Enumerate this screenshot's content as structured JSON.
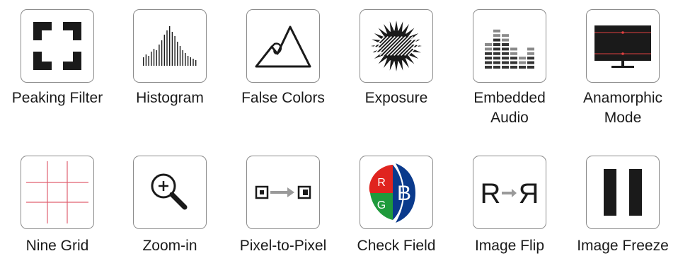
{
  "features": [
    {
      "label": "Peaking Filter",
      "icon": "peaking-filter-icon"
    },
    {
      "label": "Histogram",
      "icon": "histogram-icon"
    },
    {
      "label": "False Colors",
      "icon": "false-colors-icon"
    },
    {
      "label": "Exposure",
      "icon": "exposure-icon"
    },
    {
      "label": "Embedded\nAudio",
      "icon": "embedded-audio-icon"
    },
    {
      "label": "Anamorphic\nMode",
      "icon": "anamorphic-mode-icon"
    },
    {
      "label": "Nine Grid",
      "icon": "nine-grid-icon"
    },
    {
      "label": "Zoom-in",
      "icon": "zoom-in-icon"
    },
    {
      "label": "Pixel-to-Pixel",
      "icon": "pixel-to-pixel-icon"
    },
    {
      "label": "Check Field",
      "icon": "check-field-icon"
    },
    {
      "label": "Image Flip",
      "icon": "image-flip-icon"
    },
    {
      "label": "Image Freeze",
      "icon": "image-freeze-icon"
    }
  ],
  "check_field": {
    "r": "R",
    "g": "G",
    "b": "B",
    "colors": {
      "red": "#e0241f",
      "green": "#1f9a3c",
      "blue": "#0a3a8c"
    }
  },
  "image_flip": {
    "left": "R",
    "right": "R"
  },
  "accent": {
    "grid_red": "#e06070",
    "audio_bar": "#333333"
  }
}
